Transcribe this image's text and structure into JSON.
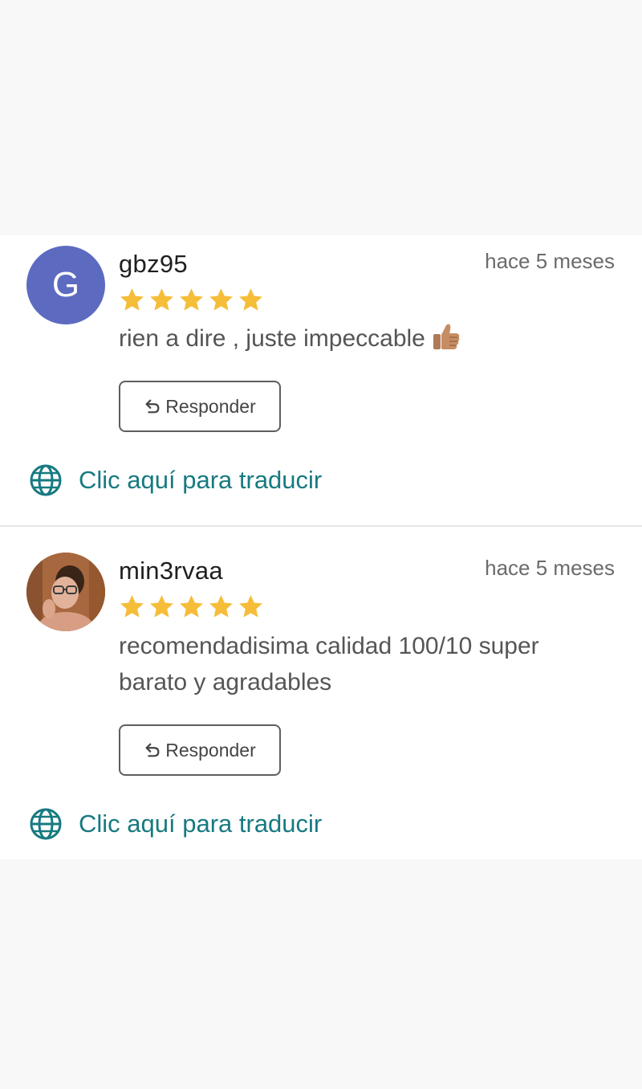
{
  "colors": {
    "star": "#f6bd39",
    "link": "#177a80",
    "avatar_initial_bg": "#5c6bc0",
    "page_bg": "#f8f8f9"
  },
  "reviews": [
    {
      "avatar_initial": "G",
      "avatar_kind": "initial-letter",
      "username": "gbz95",
      "timestamp": "hace 5 meses",
      "rating": 5,
      "text": "rien a dire , juste impeccable",
      "emoji": "thumbs-up-medium-skin-tone",
      "reply_label": "Responder",
      "translate_label": "Clic aquí para traducir"
    },
    {
      "avatar_kind": "user-photo",
      "username": "min3rvaa",
      "timestamp": "hace 5 meses",
      "rating": 5,
      "text": "recomendadisima calidad  100/10 super barato y agradables",
      "reply_label": "Responder",
      "translate_label": "Clic aquí para traducir"
    }
  ]
}
